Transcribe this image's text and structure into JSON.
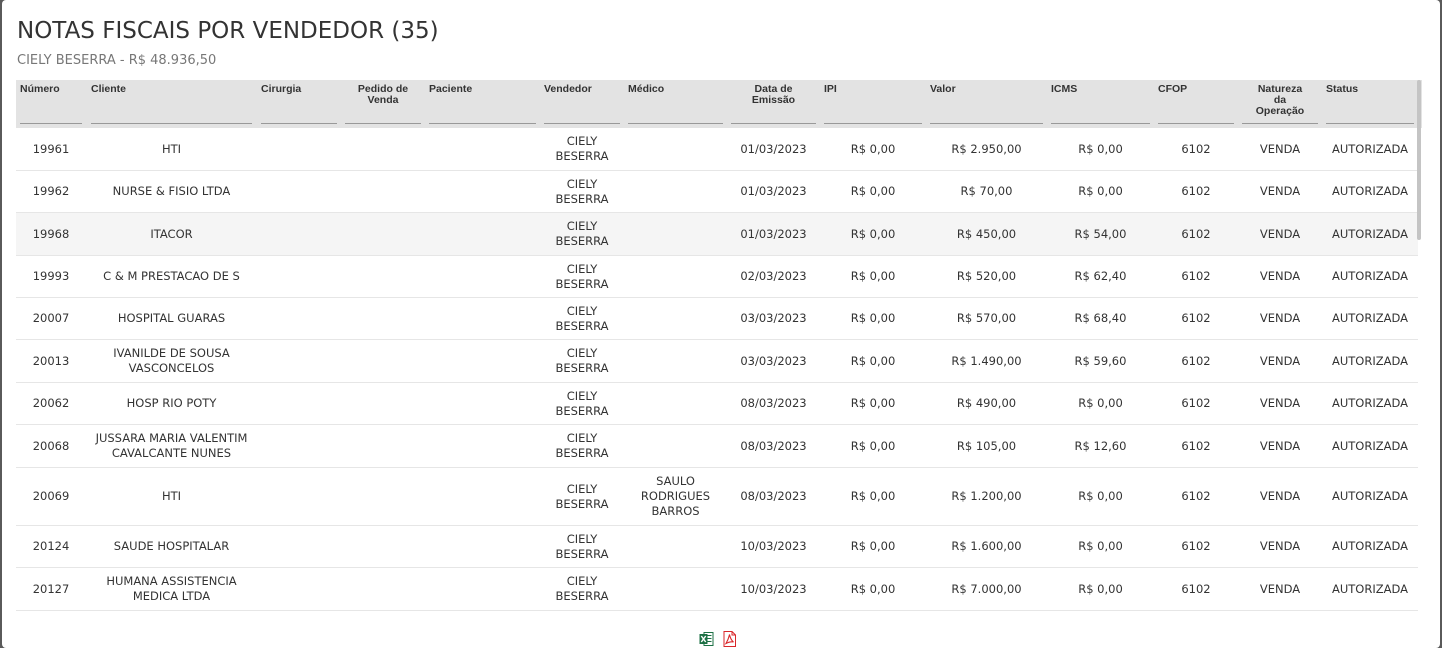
{
  "modal": {
    "title": "NOTAS FISCAIS POR VENDEDOR (35)",
    "subtitle": "CIELY BESERRA - R$ 48.936,50"
  },
  "table": {
    "columns": [
      {
        "label": "Número"
      },
      {
        "label": "Cliente"
      },
      {
        "label": "Cirurgia"
      },
      {
        "label": "Pedido de Venda"
      },
      {
        "label": "Paciente"
      },
      {
        "label": "Vendedor"
      },
      {
        "label": "Médico"
      },
      {
        "label": "Data de Emissão"
      },
      {
        "label": "IPI"
      },
      {
        "label": "Valor"
      },
      {
        "label": "ICMS"
      },
      {
        "label": "CFOP"
      },
      {
        "label": "Natureza da Operação"
      },
      {
        "label": "Status"
      }
    ],
    "rows": [
      {
        "numero": "19961",
        "cliente": "HTI",
        "cirurgia": "",
        "pedido": "",
        "paciente": "",
        "vendedor": "CIELY BESERRA",
        "medico": "",
        "data": "01/03/2023",
        "ipi": "R$ 0,00",
        "valor": "R$ 2.950,00",
        "icms": "R$ 0,00",
        "cfop": "6102",
        "natureza": "VENDA",
        "status": "AUTORIZADA"
      },
      {
        "numero": "19962",
        "cliente": "NURSE & FISIO LTDA",
        "cirurgia": "",
        "pedido": "",
        "paciente": "",
        "vendedor": "CIELY BESERRA",
        "medico": "",
        "data": "01/03/2023",
        "ipi": "R$ 0,00",
        "valor": "R$ 70,00",
        "icms": "R$ 0,00",
        "cfop": "6102",
        "natureza": "VENDA",
        "status": "AUTORIZADA"
      },
      {
        "numero": "19968",
        "cliente": "ITACOR",
        "cirurgia": "",
        "pedido": "",
        "paciente": "",
        "vendedor": "CIELY BESERRA",
        "medico": "",
        "data": "01/03/2023",
        "ipi": "R$ 0,00",
        "valor": "R$ 450,00",
        "icms": "R$ 54,00",
        "cfop": "6102",
        "natureza": "VENDA",
        "status": "AUTORIZADA"
      },
      {
        "numero": "19993",
        "cliente": "C & M PRESTACAO DE S",
        "cirurgia": "",
        "pedido": "",
        "paciente": "",
        "vendedor": "CIELY BESERRA",
        "medico": "",
        "data": "02/03/2023",
        "ipi": "R$ 0,00",
        "valor": "R$ 520,00",
        "icms": "R$ 62,40",
        "cfop": "6102",
        "natureza": "VENDA",
        "status": "AUTORIZADA"
      },
      {
        "numero": "20007",
        "cliente": "HOSPITAL GUARAS",
        "cirurgia": "",
        "pedido": "",
        "paciente": "",
        "vendedor": "CIELY BESERRA",
        "medico": "",
        "data": "03/03/2023",
        "ipi": "R$ 0,00",
        "valor": "R$ 570,00",
        "icms": "R$ 68,40",
        "cfop": "6102",
        "natureza": "VENDA",
        "status": "AUTORIZADA"
      },
      {
        "numero": "20013",
        "cliente": "IVANILDE DE SOUSA VASCONCELOS",
        "cirurgia": "",
        "pedido": "",
        "paciente": "",
        "vendedor": "CIELY BESERRA",
        "medico": "",
        "data": "03/03/2023",
        "ipi": "R$ 0,00",
        "valor": "R$ 1.490,00",
        "icms": "R$ 59,60",
        "cfop": "6102",
        "natureza": "VENDA",
        "status": "AUTORIZADA"
      },
      {
        "numero": "20062",
        "cliente": "HOSP RIO POTY",
        "cirurgia": "",
        "pedido": "",
        "paciente": "",
        "vendedor": "CIELY BESERRA",
        "medico": "",
        "data": "08/03/2023",
        "ipi": "R$ 0,00",
        "valor": "R$ 490,00",
        "icms": "R$ 0,00",
        "cfop": "6102",
        "natureza": "VENDA",
        "status": "AUTORIZADA"
      },
      {
        "numero": "20068",
        "cliente": "JUSSARA MARIA VALENTIM CAVALCANTE NUNES",
        "cirurgia": "",
        "pedido": "",
        "paciente": "",
        "vendedor": "CIELY BESERRA",
        "medico": "",
        "data": "08/03/2023",
        "ipi": "R$ 0,00",
        "valor": "R$ 105,00",
        "icms": "R$ 12,60",
        "cfop": "6102",
        "natureza": "VENDA",
        "status": "AUTORIZADA"
      },
      {
        "numero": "20069",
        "cliente": "HTI",
        "cirurgia": "",
        "pedido": "",
        "paciente": "",
        "vendedor": "CIELY BESERRA",
        "medico": "SAULO RODRIGUES BARROS",
        "data": "08/03/2023",
        "ipi": "R$ 0,00",
        "valor": "R$ 1.200,00",
        "icms": "R$ 0,00",
        "cfop": "6102",
        "natureza": "VENDA",
        "status": "AUTORIZADA"
      },
      {
        "numero": "20124",
        "cliente": "SAUDE HOSPITALAR",
        "cirurgia": "",
        "pedido": "",
        "paciente": "",
        "vendedor": "CIELY BESERRA",
        "medico": "",
        "data": "10/03/2023",
        "ipi": "R$ 0,00",
        "valor": "R$ 1.600,00",
        "icms": "R$ 0,00",
        "cfop": "6102",
        "natureza": "VENDA",
        "status": "AUTORIZADA"
      },
      {
        "numero": "20127",
        "cliente": "HUMANA ASSISTENCIA MEDICA LTDA",
        "cirurgia": "",
        "pedido": "",
        "paciente": "",
        "vendedor": "CIELY BESERRA",
        "medico": "",
        "data": "10/03/2023",
        "ipi": "R$ 0,00",
        "valor": "R$ 7.000,00",
        "icms": "R$ 0,00",
        "cfop": "6102",
        "natureza": "VENDA",
        "status": "AUTORIZADA"
      }
    ]
  },
  "export": {
    "excel_icon": "excel-icon",
    "pdf_icon": "pdf-icon",
    "excel_color": "#1d7044",
    "pdf_color": "#d9262a"
  }
}
